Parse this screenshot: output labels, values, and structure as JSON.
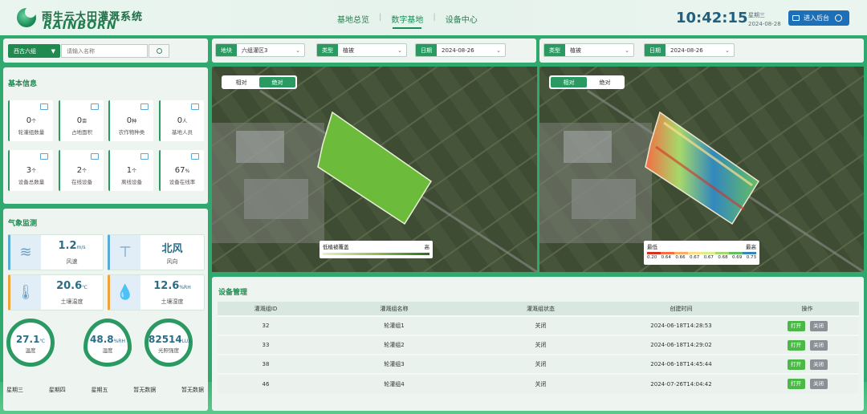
{
  "header": {
    "logo_cn": "雨生云大田灌溉系统",
    "logo_en": "RAINBORN",
    "nav": [
      {
        "label": "基地总览",
        "active": false
      },
      {
        "label": "数字基地",
        "active": true
      },
      {
        "label": "设备中心",
        "active": false
      }
    ],
    "time": "10:42:15",
    "weekday": "星期三",
    "date": "2024-08-28",
    "enter_label": "进入后台"
  },
  "left": {
    "base_select": "西古六组",
    "search_placeholder": "请输入名称",
    "basic_title": "基本信息",
    "stats": [
      {
        "value": "0",
        "unit": "个",
        "label": "轮灌组数量"
      },
      {
        "value": "0",
        "unit": "亩",
        "label": "占地面积"
      },
      {
        "value": "0",
        "unit": "种",
        "label": "农作物种类"
      },
      {
        "value": "0",
        "unit": "人",
        "label": "基地人员"
      },
      {
        "value": "3",
        "unit": "个",
        "label": "设备总数量"
      },
      {
        "value": "2",
        "unit": "个",
        "label": "在线设备"
      },
      {
        "value": "1",
        "unit": "个",
        "label": "离线设备"
      },
      {
        "value": "67",
        "unit": "%",
        "label": "设备在线率"
      }
    ],
    "weather_title": "气象监测",
    "weather": [
      {
        "value": "1.2",
        "unit": "m/s",
        "label": "风速",
        "icon": "wind-icon"
      },
      {
        "value": "北风",
        "unit": "",
        "label": "风向",
        "icon": "wind-vane-icon"
      },
      {
        "value": "20.6",
        "unit": "℃",
        "label": "土壤温度",
        "icon": "thermometer-icon"
      },
      {
        "value": "12.6",
        "unit": "%RH",
        "label": "土壤湿度",
        "icon": "droplet-icon"
      }
    ],
    "rings": [
      {
        "value": "27.1",
        "unit": "℃",
        "label": "温度"
      },
      {
        "value": "48.8",
        "unit": "%RH",
        "label": "湿度"
      },
      {
        "value": "82514",
        "unit": "LUX",
        "label": "光照强度"
      }
    ],
    "days": [
      "星期三",
      "星期四",
      "星期五",
      "暂无数据",
      "暂无数据"
    ]
  },
  "map_left": {
    "plot_key": "地块",
    "plot_value": "六组灌区3",
    "type_key": "类型",
    "type_value": "植被",
    "date_key": "日期",
    "date_value": "2024-08-26",
    "toggle": [
      "相对",
      "绝对"
    ],
    "toggle_active": 1,
    "legend_low": "低植被覆盖",
    "legend_high": "高"
  },
  "map_right": {
    "type_key": "类型",
    "type_value": "植被",
    "date_key": "日期",
    "date_value": "2024-08-26",
    "toggle": [
      "相对",
      "绝对"
    ],
    "toggle_active": 0,
    "legend_low": "最低",
    "legend_high": "最高",
    "legend_ticks": [
      "0.20",
      "0.64",
      "0.66",
      "0.67",
      "0.67",
      "0.68",
      "0.69",
      "0.73"
    ],
    "legend_colors": [
      "#d7301f",
      "#f46d43",
      "#fdae61",
      "#fee08b",
      "#d9ef8b",
      "#a6d96a",
      "#66bd63",
      "#3288bd"
    ]
  },
  "device": {
    "title": "设备管理",
    "columns": [
      "灌溉组ID",
      "灌溉组名称",
      "灌溉组状态",
      "创建时间",
      "操作"
    ],
    "rows": [
      [
        "32",
        "轮灌组1",
        "关闭",
        "2024-06-18T14:28:53"
      ],
      [
        "33",
        "轮灌组2",
        "关闭",
        "2024-06-18T14:29:02"
      ],
      [
        "38",
        "轮灌组3",
        "关闭",
        "2024-06-18T14:45:44"
      ],
      [
        "46",
        "轮灌组4",
        "关闭",
        "2024-07-26T14:04:42"
      ]
    ],
    "open_label": "打开",
    "close_label": "关闭"
  }
}
